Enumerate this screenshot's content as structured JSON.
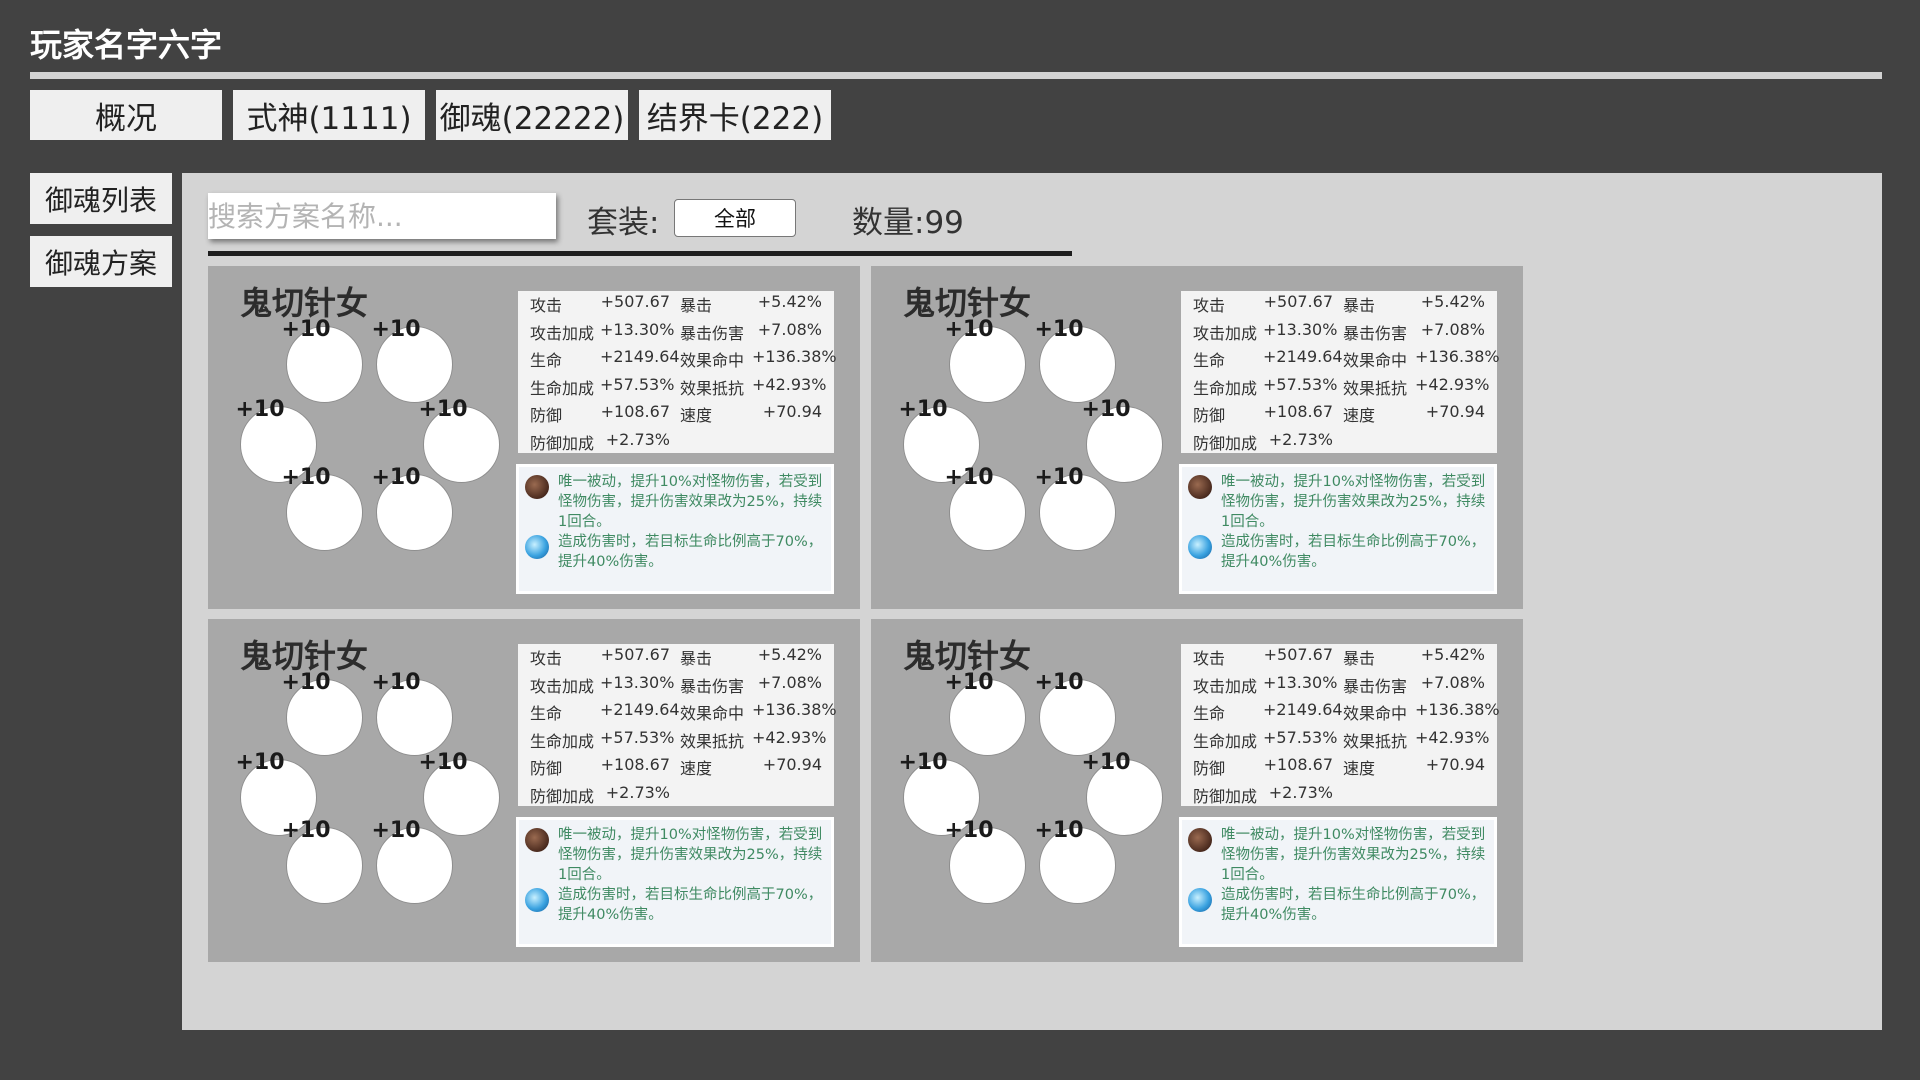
{
  "player": {
    "name": "玩家名字六字"
  },
  "tabs": [
    {
      "label": "概况"
    },
    {
      "label": "式神(1111)"
    },
    {
      "label": "御魂(22222)"
    },
    {
      "label": "结界卡(222)"
    }
  ],
  "side_nav": [
    {
      "label": "御魂列表"
    },
    {
      "label": "御魂方案"
    }
  ],
  "toolbar": {
    "search_placeholder": "搜索方案名称...",
    "set_label": "套装:",
    "set_value": "全部",
    "count_label": "数量:99"
  },
  "cards": [
    {
      "title": "鬼切针女",
      "slots": [
        "+10",
        "+10",
        "+10",
        "+10",
        "+10",
        "+10"
      ],
      "stats": [
        {
          "name": "攻击",
          "value": "+507.67"
        },
        {
          "name": "暴击",
          "value": "+5.42%"
        },
        {
          "name": "攻击加成",
          "value": "+13.30%"
        },
        {
          "name": "暴击伤害",
          "value": "+7.08%"
        },
        {
          "name": "生命",
          "value": "+2149.64"
        },
        {
          "name": "效果命中",
          "value": "+136.38%"
        },
        {
          "name": "生命加成",
          "value": "+57.53%"
        },
        {
          "name": "效果抵抗",
          "value": "+42.93%"
        },
        {
          "name": "防御",
          "value": "+108.67"
        },
        {
          "name": "速度",
          "value": "+70.94"
        },
        {
          "name": "防御加成",
          "value": "+2.73%"
        }
      ],
      "effects": [
        {
          "icon": "dark-orb-icon",
          "text": "唯一被动，提升10%对怪物伤害，若受到怪物伤害，提升伤害效果改为25%，持续1回合。"
        },
        {
          "icon": "blue-orb-icon",
          "text": "造成伤害时，若目标生命比例高于70%，提升40%伤害。"
        }
      ]
    },
    {
      "title": "鬼切针女",
      "slots": [
        "+10",
        "+10",
        "+10",
        "+10",
        "+10",
        "+10"
      ],
      "stats": [
        {
          "name": "攻击",
          "value": "+507.67"
        },
        {
          "name": "暴击",
          "value": "+5.42%"
        },
        {
          "name": "攻击加成",
          "value": "+13.30%"
        },
        {
          "name": "暴击伤害",
          "value": "+7.08%"
        },
        {
          "name": "生命",
          "value": "+2149.64"
        },
        {
          "name": "效果命中",
          "value": "+136.38%"
        },
        {
          "name": "生命加成",
          "value": "+57.53%"
        },
        {
          "name": "效果抵抗",
          "value": "+42.93%"
        },
        {
          "name": "防御",
          "value": "+108.67"
        },
        {
          "name": "速度",
          "value": "+70.94"
        },
        {
          "name": "防御加成",
          "value": "+2.73%"
        }
      ],
      "effects": [
        {
          "icon": "dark-orb-icon",
          "text": "唯一被动，提升10%对怪物伤害，若受到怪物伤害，提升伤害效果改为25%，持续1回合。"
        },
        {
          "icon": "blue-orb-icon",
          "text": "造成伤害时，若目标生命比例高于70%，提升40%伤害。"
        }
      ]
    },
    {
      "title": "鬼切针女",
      "slots": [
        "+10",
        "+10",
        "+10",
        "+10",
        "+10",
        "+10"
      ],
      "stats": [
        {
          "name": "攻击",
          "value": "+507.67"
        },
        {
          "name": "暴击",
          "value": "+5.42%"
        },
        {
          "name": "攻击加成",
          "value": "+13.30%"
        },
        {
          "name": "暴击伤害",
          "value": "+7.08%"
        },
        {
          "name": "生命",
          "value": "+2149.64"
        },
        {
          "name": "效果命中",
          "value": "+136.38%"
        },
        {
          "name": "生命加成",
          "value": "+57.53%"
        },
        {
          "name": "效果抵抗",
          "value": "+42.93%"
        },
        {
          "name": "防御",
          "value": "+108.67"
        },
        {
          "name": "速度",
          "value": "+70.94"
        },
        {
          "name": "防御加成",
          "value": "+2.73%"
        }
      ],
      "effects": [
        {
          "icon": "dark-orb-icon",
          "text": "唯一被动，提升10%对怪物伤害，若受到怪物伤害，提升伤害效果改为25%，持续1回合。"
        },
        {
          "icon": "blue-orb-icon",
          "text": "造成伤害时，若目标生命比例高于70%，提升40%伤害。"
        }
      ]
    },
    {
      "title": "鬼切针女",
      "slots": [
        "+10",
        "+10",
        "+10",
        "+10",
        "+10",
        "+10"
      ],
      "stats": [
        {
          "name": "攻击",
          "value": "+507.67"
        },
        {
          "name": "暴击",
          "value": "+5.42%"
        },
        {
          "name": "攻击加成",
          "value": "+13.30%"
        },
        {
          "name": "暴击伤害",
          "value": "+7.08%"
        },
        {
          "name": "生命",
          "value": "+2149.64"
        },
        {
          "name": "效果命中",
          "value": "+136.38%"
        },
        {
          "name": "生命加成",
          "value": "+57.53%"
        },
        {
          "name": "效果抵抗",
          "value": "+42.93%"
        },
        {
          "name": "防御",
          "value": "+108.67"
        },
        {
          "name": "速度",
          "value": "+70.94"
        },
        {
          "name": "防御加成",
          "value": "+2.73%"
        }
      ],
      "effects": [
        {
          "icon": "dark-orb-icon",
          "text": "唯一被动，提升10%对怪物伤害，若受到怪物伤害，提升伤害效果改为25%，持续1回合。"
        },
        {
          "icon": "blue-orb-icon",
          "text": "造成伤害时，若目标生命比例高于70%，提升40%伤害。"
        }
      ]
    }
  ]
}
